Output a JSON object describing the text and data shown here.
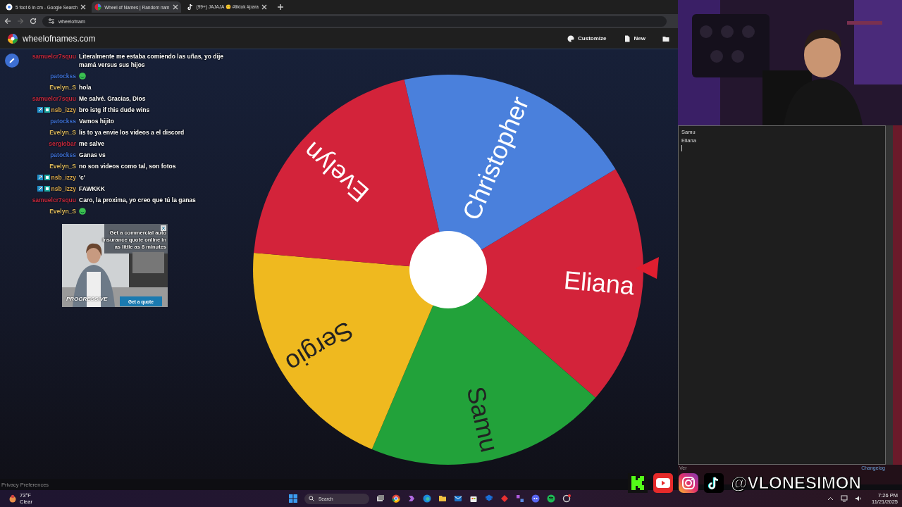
{
  "browser": {
    "tabs": [
      {
        "title": "5 foot 6 in cm - Google Search",
        "selected": false
      },
      {
        "title": "Wheel of Names | Random nam",
        "selected": true
      },
      {
        "title": "(99+) JAJAJA 😊 #tiktok #para",
        "selected": false
      }
    ],
    "address": "wheelofnam"
  },
  "site": {
    "title": "wheelofnames.com",
    "actions": [
      {
        "kind": "palette",
        "label": "Customize"
      },
      {
        "kind": "file",
        "label": "New"
      },
      {
        "kind": "folder"
      }
    ]
  },
  "wheel": {
    "entries": [
      {
        "label": "Eliana",
        "color": "#d3233a"
      },
      {
        "label": "Samu",
        "color": "#22a23a"
      },
      {
        "label": "Sergio",
        "color": "#efb91f"
      },
      {
        "label": "Evelyn",
        "color": "#d3233a"
      },
      {
        "label": "Christopher",
        "color": "#4a80dc"
      }
    ]
  },
  "entries_panel": {
    "lines": [
      "Samu",
      "Eliana"
    ],
    "version": "Ver",
    "changelog": "Changelog"
  },
  "footer": "Privacy Preferences",
  "chat": [
    {
      "user": "samuelcr7squu",
      "color": "#c3283c",
      "badges": false,
      "text": "Literalmente me estaba comiendo las uñas, yo dije mamá versus sus hijos"
    },
    {
      "user": "patockss",
      "color": "#3d6fd2",
      "badges": false,
      "emote": true
    },
    {
      "user": "Evelyn_S",
      "color": "#d9b65a",
      "badges": false,
      "text": "hola"
    },
    {
      "user": "samuelcr7squu",
      "color": "#c3283c",
      "badges": false,
      "text": "Me salvé. Gracias, Dios"
    },
    {
      "user": "nsb_izzy",
      "color": "#d9a84a",
      "badges": true,
      "text": "bro istg if this dude wins"
    },
    {
      "user": "patockss",
      "color": "#3d6fd2",
      "badges": false,
      "text": "Vamos hijito"
    },
    {
      "user": "Evelyn_S",
      "color": "#d9b65a",
      "badges": false,
      "text": "lis to ya envie los videos a el discord"
    },
    {
      "user": "sergiobar",
      "color": "#c3283c",
      "badges": false,
      "text": "me salve"
    },
    {
      "user": "patockss",
      "color": "#3d6fd2",
      "badges": false,
      "text": "Ganas vs"
    },
    {
      "user": "Evelyn_S",
      "color": "#d9b65a",
      "badges": false,
      "text": "no son videos como tal, son fotos"
    },
    {
      "user": "nsb_izzy",
      "color": "#d9a84a",
      "badges": true,
      "text": "'c'"
    },
    {
      "user": "nsb_izzy",
      "color": "#d9a84a",
      "badges": true,
      "text": "FAWKKK"
    },
    {
      "user": "samuelcr7squu",
      "color": "#c3283c",
      "badges": false,
      "text": "Caro, la proxima, yo creo que tú la ganas"
    },
    {
      "user": "Evelyn_S",
      "color": "#d9b65a",
      "badges": false,
      "emote": true
    }
  ],
  "ad": {
    "headline": "Get a commercial auto insurance quote online in as little as 8 minutes",
    "brand": "PROGRESSIVE",
    "button": "Get a quote"
  },
  "socials": {
    "handle": "@VLONESIMON"
  },
  "taskbar": {
    "temperature": "73°F",
    "condition": "Clear",
    "search": "Search",
    "time": "7:26 PM",
    "date": "11/21/2025"
  }
}
